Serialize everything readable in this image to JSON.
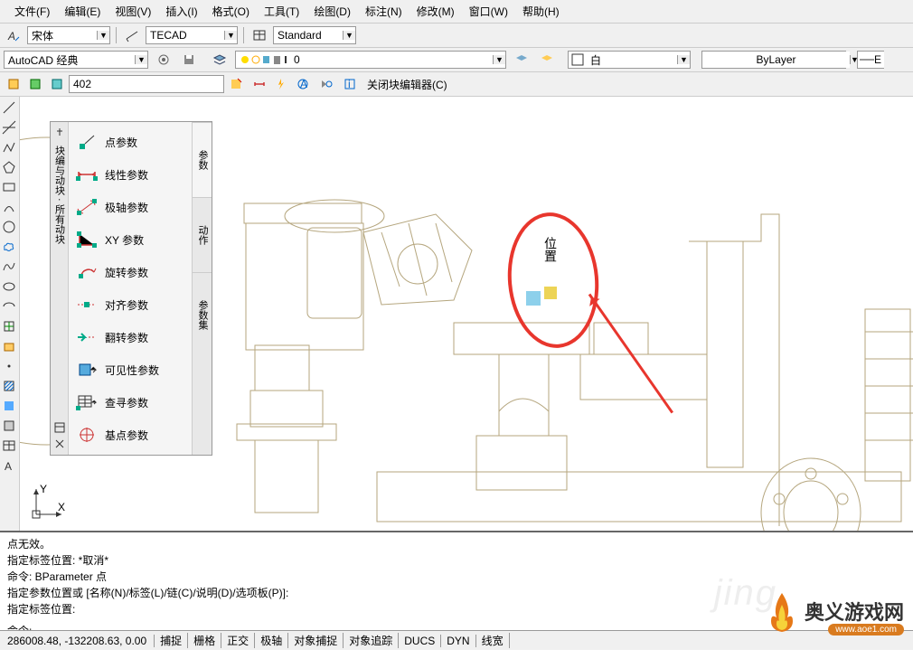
{
  "menu": {
    "items": [
      "文件(F)",
      "编辑(E)",
      "视图(V)",
      "插入(I)",
      "格式(O)",
      "工具(T)",
      "绘图(D)",
      "标注(N)",
      "修改(M)",
      "窗口(W)",
      "帮助(H)"
    ]
  },
  "toolbar1": {
    "font": "宋体",
    "style1": "TECAD",
    "style2": "Standard"
  },
  "toolbar2": {
    "workspace": "AutoCAD 经典",
    "layer_value": "0",
    "color": "白",
    "linetype": "ByLayer"
  },
  "toolbar3": {
    "input": "402",
    "close_label": "关闭块编辑器(C)"
  },
  "params": {
    "title": "块编与动块 · 所有动块",
    "items": [
      {
        "label": "点参数"
      },
      {
        "label": "线性参数"
      },
      {
        "label": "极轴参数"
      },
      {
        "label": "XY 参数"
      },
      {
        "label": "旋转参数"
      },
      {
        "label": "对齐参数"
      },
      {
        "label": "翻转参数"
      },
      {
        "label": "可见性参数"
      },
      {
        "label": "查寻参数"
      },
      {
        "label": "基点参数"
      }
    ],
    "side_tabs": [
      "参数",
      "动作",
      "参数集"
    ]
  },
  "annotation": {
    "position_label": "位置"
  },
  "cmdline": {
    "lines": [
      "点无效。",
      "指定标签位置:   *取消*",
      "命令:  BParameter 点",
      "指定参数位置或 [名称(N)/标签(L)/链(C)/说明(D)/选项板(P)]:",
      "指定标签位置:"
    ],
    "prompt": "命令:"
  },
  "statusbar": {
    "coords": "286008.48, -132208.63, 0.00",
    "buttons": [
      "捕捉",
      "栅格",
      "正交",
      "极轴",
      "对象捕捉",
      "对象追踪",
      "DUCS",
      "DYN",
      "线宽"
    ]
  },
  "watermark": {
    "text": "奥义游戏网",
    "url": "www.aoe1.com"
  }
}
